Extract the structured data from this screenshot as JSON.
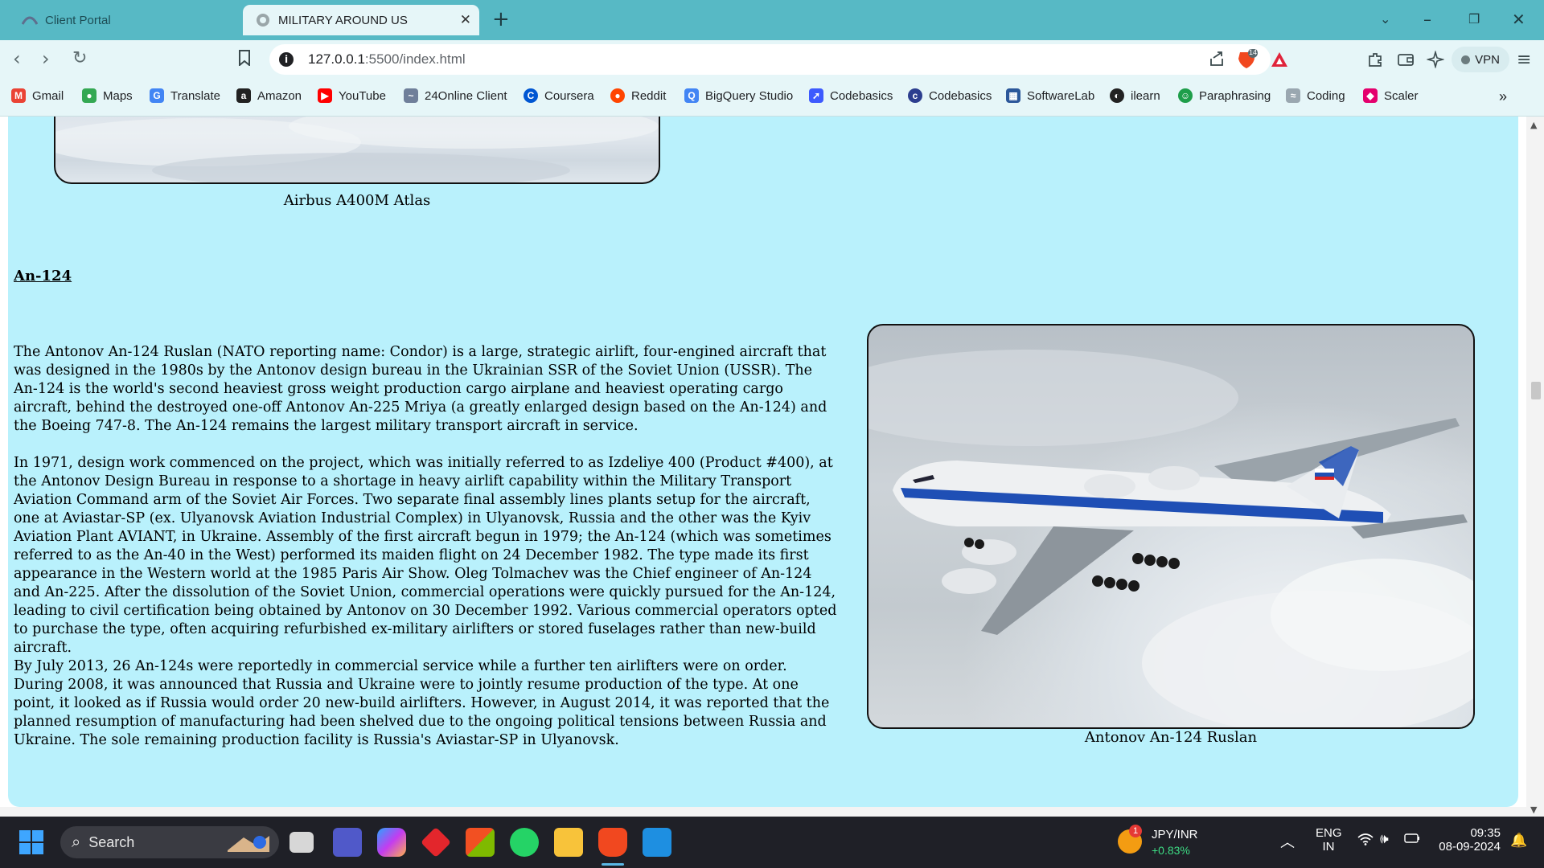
{
  "browser": {
    "tabs": [
      {
        "title": "Client Portal",
        "active": false
      },
      {
        "title": "MILITARY AROUND US",
        "active": true
      }
    ],
    "url_host": "127.0.0.1",
    "url_rest": ":5500/index.html",
    "shield_badge": "14",
    "vpn_label": "VPN"
  },
  "bookmarks": [
    {
      "label": "Gmail",
      "icon": "gmail-icon",
      "color": "#ea4335",
      "glyph": "M"
    },
    {
      "label": "Maps",
      "icon": "maps-pin-icon",
      "color": "#34a853",
      "glyph": "●"
    },
    {
      "label": "Translate",
      "icon": "translate-icon",
      "color": "#4285f4",
      "glyph": "G"
    },
    {
      "label": "Amazon",
      "icon": "amazon-icon",
      "color": "#222222",
      "glyph": "a"
    },
    {
      "label": "YouTube",
      "icon": "youtube-icon",
      "color": "#ff0000",
      "glyph": "▶"
    },
    {
      "label": "24Online Client",
      "icon": "24online-icon",
      "color": "#6f7f9a",
      "glyph": "~"
    },
    {
      "label": "Coursera",
      "icon": "coursera-icon",
      "color": "#0056d2",
      "glyph": "C"
    },
    {
      "label": "Reddit",
      "icon": "reddit-icon",
      "color": "#ff4500",
      "glyph": "●"
    },
    {
      "label": "BigQuery Studio",
      "icon": "bigquery-icon",
      "color": "#4285f4",
      "glyph": "Q"
    },
    {
      "label": "Codebasics",
      "icon": "rocket-icon",
      "color": "#3d5afe",
      "glyph": "➚"
    },
    {
      "label": "Codebasics",
      "icon": "codebasics-icon",
      "color": "#2c3e8f",
      "glyph": "c"
    },
    {
      "label": "SoftwareLab",
      "icon": "softwarelab-icon",
      "color": "#2b579a",
      "glyph": "▦"
    },
    {
      "label": "ilearn",
      "icon": "globe-icon",
      "color": "#222222",
      "glyph": "◐"
    },
    {
      "label": "Paraphrasing",
      "icon": "paraphrasing-icon",
      "color": "#1e9e4a",
      "glyph": "☺"
    },
    {
      "label": "Coding",
      "icon": "coding-icon",
      "color": "#9aa7b0",
      "glyph": "≈"
    },
    {
      "label": "Scaler",
      "icon": "scaler-icon",
      "color": "#e4006d",
      "glyph": "◆"
    }
  ],
  "content": {
    "top_caption": "Airbus A400M Atlas",
    "heading": "An-124",
    "paragraphs": [
      "The Antonov An-124 Ruslan (NATO reporting name: Condor) is a large, strategic airlift, four-engined aircraft that was designed in the 1980s by the Antonov design bureau in the Ukrainian SSR of the Soviet Union (USSR). The An-124 is the world's second heaviest gross weight production cargo airplane and heaviest operating cargo aircraft, behind the destroyed one-off Antonov An-225 Mriya (a greatly enlarged design based on the An-124) and the Boeing 747-8. The An-124 remains the largest military transport aircraft in service.",
      "In 1971, design work commenced on the project, which was initially referred to as Izdeliye 400 (Product #400), at the Antonov Design Bureau in response to a shortage in heavy airlift capability within the Military Transport Aviation Command arm of the Soviet Air Forces. Two separate final assembly lines plants setup for the aircraft, one at Aviastar-SP (ex. Ulyanovsk Aviation Industrial Complex) in Ulyanovsk, Russia and the other was the Kyiv Aviation Plant AVIANT, in Ukraine. Assembly of the first aircraft begun in 1979; the An-124 (which was sometimes referred to as the An-40 in the West) performed its maiden flight on 24 December 1982. The type made its first appearance in the Western world at the 1985 Paris Air Show. Oleg Tolmachev was the Chief engineer of An-124 and An-225. After the dissolution of the Soviet Union, commercial operations were quickly pursued for the An-124, leading to civil certification being obtained by Antonov on 30 December 1992. Various commercial operators opted to purchase the type, often acquiring refurbished ex-military airlifters or stored fuselages rather than new-build aircraft.",
      "By July 2013, 26 An-124s were reportedly in commercial service while a further ten airlifters were on order. During 2008, it was announced that Russia and Ukraine were to jointly resume production of the type. At one point, it looked as if Russia would order 20 new-build airlifters. However, in August 2014, it was reported that the planned resumption of manufacturing had been shelved due to the ongoing political tensions between Russia and Ukraine. The sole remaining production facility is Russia's Aviastar-SP in Ulyanovsk."
    ],
    "image_caption": "Antonov An-124 Ruslan"
  },
  "taskbar": {
    "search_label": "Search",
    "ticker_symbol": "JPY/INR",
    "ticker_change": "+0.83%",
    "ticker_badge": "1",
    "lang_line1": "ENG",
    "lang_line2": "IN",
    "time": "09:35",
    "date": "08-09-2024"
  },
  "colors": {
    "tab_strip": "#57b9c5",
    "toolbar": "#e6f6f8",
    "page_background": "#b9f1fc",
    "taskbar": "#1f2027",
    "ticker_positive": "#3ddc84"
  }
}
